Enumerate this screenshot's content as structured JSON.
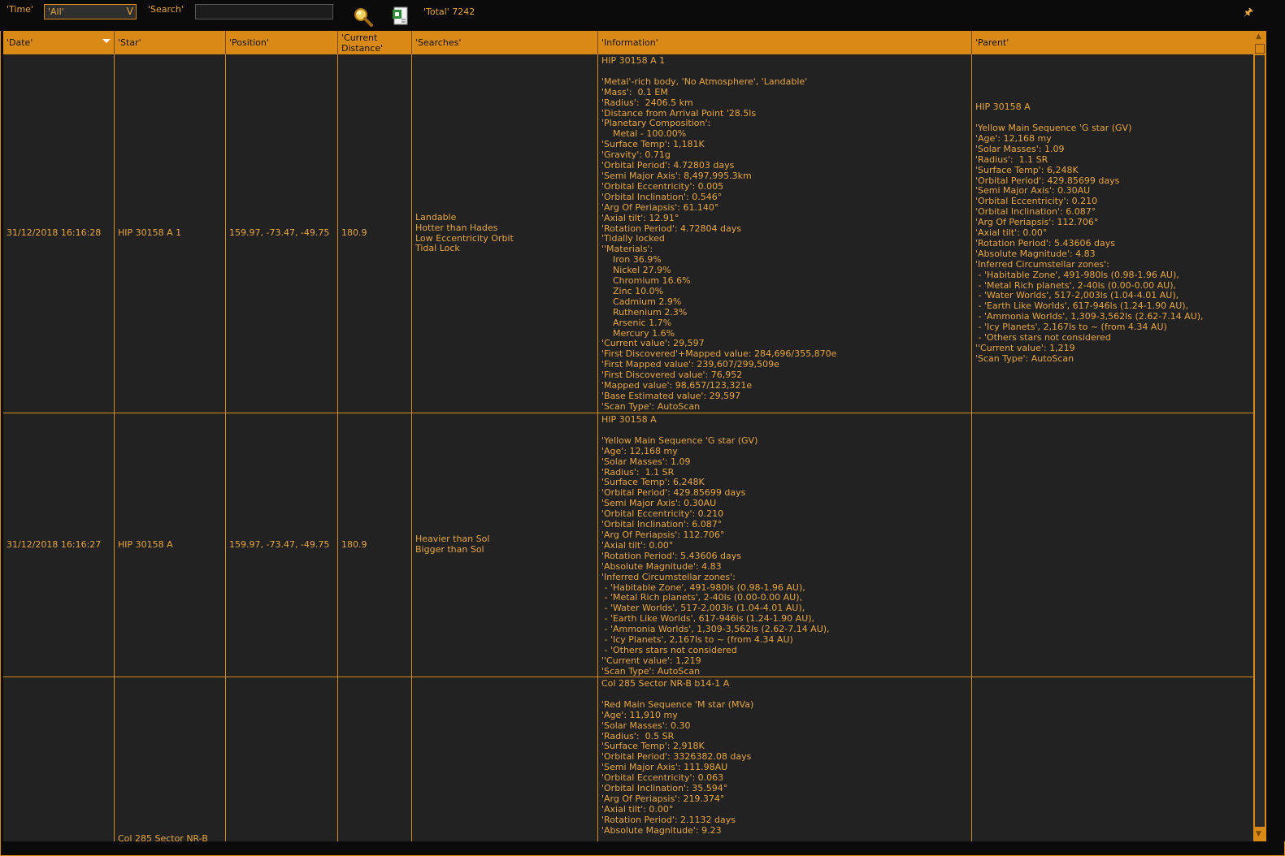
{
  "toolbar": {
    "time_label": "'Time'",
    "time_value": "'All'",
    "search_label": "'Search'",
    "search_value": "",
    "total_label": "'Total' 7242"
  },
  "columns": [
    "'Date'",
    "'Star'",
    "'Position'",
    "'Current\nDistance'",
    "'Searches'",
    "'Information'",
    "'Parent'"
  ],
  "rows": [
    {
      "date": "31/12/2018 16:16:28",
      "star": "HIP 30158 A 1",
      "position": "159.97, -73.47, -49.75",
      "distance": "180.9",
      "searches": "Landable\nHotter than Hades\nLow Eccentricity Orbit\nTidal Lock",
      "information": "HIP 30158 A 1\n\n'Metal'-rich body, 'No Atmosphere', 'Landable'\n'Mass':  0.1 EM\n'Radius':  2406.5 km\n'Distance from Arrival Point '28.5ls\n'Planetary Composition':\n    Metal - 100.00%\n'Surface Temp': 1,181K\n'Gravity': 0.71g\n'Orbital Period': 4.72803 days\n'Semi Major Axis': 8,497,995.3km\n'Orbital Eccentricity': 0.005\n'Orbital Inclination': 0.546°\n'Arg Of Periapsis': 61.140°\n'Axial tilt': 12.91°\n'Rotation Period': 4.72804 days\n'Tidally locked\n''Materials':\n    Iron 36.9%\n    Nickel 27.9%\n    Chromium 16.6%\n    Zinc 10.0%\n    Cadmium 2.9%\n    Ruthenium 2.3%\n    Arsenic 1.7%\n    Mercury 1.6%\n'Current value': 29,597\n'First Discovered'+Mapped value: 284,696/355,870e\n'First Mapped value': 239,607/299,509e\n'First Discovered value': 76,952\n'Mapped value': 98,657/123,321e\n'Base Estimated value': 29,597\n'Scan Type': AutoScan",
      "parent": "HIP 30158 A\n\n'Yellow Main Sequence 'G star (GV)\n'Age': 12,168 my\n'Solar Masses': 1.09\n'Radius':  1.1 SR\n'Surface Temp': 6,248K\n'Orbital Period': 429.85699 days\n'Semi Major Axis': 0.30AU\n'Orbital Eccentricity': 0.210\n'Orbital Inclination': 6.087°\n'Arg Of Periapsis': 112.706°\n'Axial tilt': 0.00°\n'Rotation Period': 5.43606 days\n'Absolute Magnitude': 4.83\n'Inferred Circumstellar zones':\n - 'Habitable Zone', 491-980ls (0.98-1.96 AU),\n - 'Metal Rich planets', 2-40ls (0.00-0.00 AU),\n - 'Water Worlds', 517-2,003ls (1.04-4.01 AU),\n - 'Earth Like Worlds', 617-946ls (1.24-1.90 AU),\n - 'Ammonia Worlds', 1,309-3,562ls (2.62-7.14 AU),\n - 'Icy Planets', 2,167ls to ~ (from 4.34 AU)\n - 'Others stars not considered\n''Current value': 1,219\n'Scan Type': AutoScan"
    },
    {
      "date": "31/12/2018 16:16:27",
      "star": "HIP 30158 A",
      "position": "159.97, -73.47, -49.75",
      "distance": "180.9",
      "searches": "Heavier than Sol\nBigger than Sol",
      "information": "HIP 30158 A\n\n'Yellow Main Sequence 'G star (GV)\n'Age': 12,168 my\n'Solar Masses': 1.09\n'Radius':  1.1 SR\n'Surface Temp': 6,248K\n'Orbital Period': 429.85699 days\n'Semi Major Axis': 0.30AU\n'Orbital Eccentricity': 0.210\n'Orbital Inclination': 6.087°\n'Arg Of Periapsis': 112.706°\n'Axial tilt': 0.00°\n'Rotation Period': 5.43606 days\n'Absolute Magnitude': 4.83\n'Inferred Circumstellar zones':\n - 'Habitable Zone', 491-980ls (0.98-1.96 AU),\n - 'Metal Rich planets', 2-40ls (0.00-0.00 AU),\n - 'Water Worlds', 517-2,003ls (1.04-4.01 AU),\n - 'Earth Like Worlds', 617-946ls (1.24-1.90 AU),\n - 'Ammonia Worlds', 1,309-3,562ls (2.62-7.14 AU),\n - 'Icy Planets', 2,167ls to ~ (from 4.34 AU)\n - 'Others stars not considered\n''Current value': 1,219\n'Scan Type': AutoScan",
      "parent": ""
    },
    {
      "date": "",
      "star": "Col 285 Sector NR-B",
      "position": "",
      "distance": "",
      "searches": "",
      "information": "Col 285 Sector NR-B b14-1 A\n\n'Red Main Sequence 'M star (MVa)\n'Age': 11,910 my\n'Solar Masses': 0.30\n'Radius':  0.5 SR\n'Surface Temp': 2,918K\n'Orbital Period': 3326382.08 days\n'Semi Major Axis': 111.98AU\n'Orbital Eccentricity': 0.063\n'Orbital Inclination': 35.594°\n'Arg Of Periapsis': 219.374°\n'Axial tilt': 0.00°\n'Rotation Period': 2.1132 days\n'Absolute Magnitude': 9.23",
      "parent": ""
    }
  ]
}
